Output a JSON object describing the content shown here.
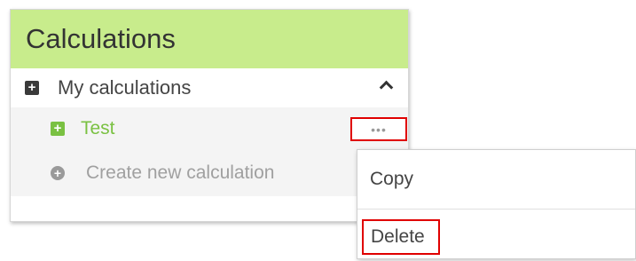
{
  "panel": {
    "title": "Calculations",
    "header_color": "#c8ec8c"
  },
  "group": {
    "label": "My calculations",
    "expand_icon": "plus-square-icon",
    "collapse_icon": "chevron-up-icon"
  },
  "items": [
    {
      "label": "Test",
      "icon": "plus-square-icon",
      "color": "#7ac142",
      "more_label": "•••"
    }
  ],
  "create": {
    "label": "Create new calculation",
    "icon": "plus-circle-icon"
  },
  "menu": {
    "items": [
      {
        "label": "Copy"
      },
      {
        "label": "Delete"
      }
    ],
    "highlight_color": "#e00000"
  }
}
